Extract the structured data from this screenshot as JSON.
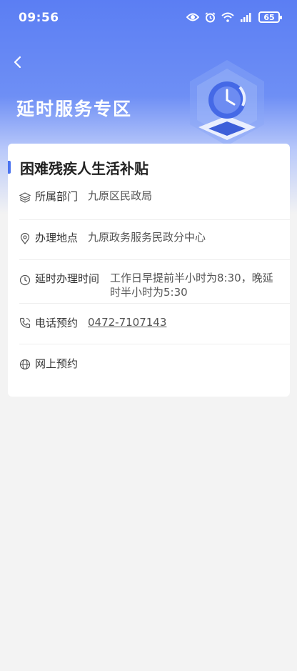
{
  "status_bar": {
    "time": "09:56",
    "battery": "65",
    "icons": [
      "eye-icon",
      "alarm-icon",
      "wifi-icon",
      "signal-icon",
      "battery-icon"
    ]
  },
  "header": {
    "back_icon": "chevron-left-icon",
    "title": "延时服务专区"
  },
  "card": {
    "title": "困难残疾人生活补贴",
    "rows": [
      {
        "icon": "layers-icon",
        "label": "所属部门",
        "value": "九原区民政局"
      },
      {
        "icon": "location-pin-icon",
        "label": "办理地点",
        "value": "九原政务服务民政分中心"
      },
      {
        "icon": "clock-icon",
        "label": "延时办理时间",
        "value_line1": "工作日早提前半小时为8:30，晚延",
        "value_line2": "时半小时为5:30"
      },
      {
        "icon": "phone-icon",
        "label": "电话预约",
        "value": "0472-7107143"
      },
      {
        "icon": "globe-icon",
        "label": "网上预约",
        "value": ""
      }
    ]
  },
  "colors": {
    "accent": "#4a73f0",
    "header_blue": "#5b7ef3",
    "link": "#2a3ec7"
  }
}
